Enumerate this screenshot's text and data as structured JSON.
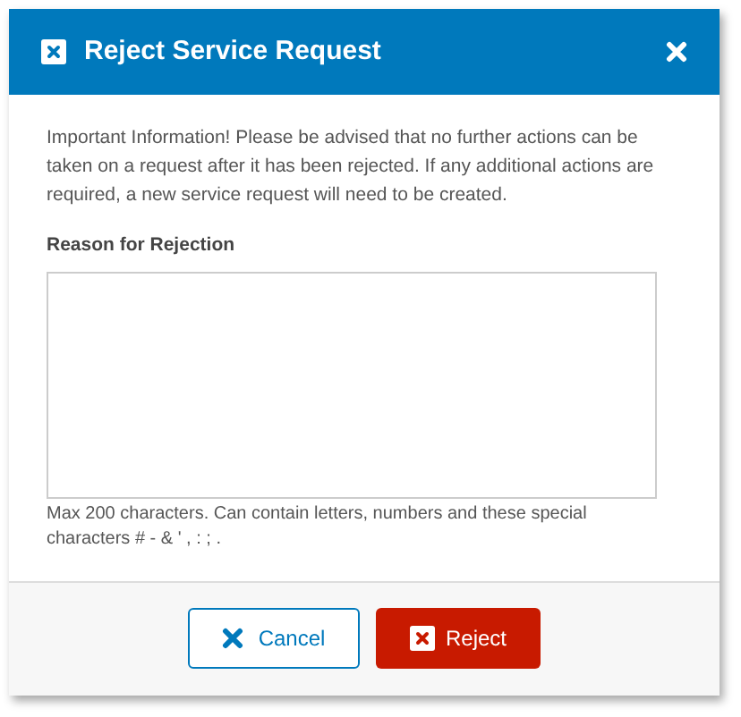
{
  "dialog": {
    "title": "Reject Service Request",
    "info": "Important Information! Please be advised that no further actions can be taken on a request after it has been rejected. If any additional actions are required, a new service request will need to be created.",
    "field": {
      "label": "Reason for Rejection"
    },
    "hint": "Max 200 characters. Can contain letters, numbers and these special characters # - & ' , : ; .",
    "buttons": [
      {
        "label": "Cancel",
        "kind": "secondary"
      },
      {
        "label": "Reject",
        "kind": "primary"
      }
    ]
  }
}
